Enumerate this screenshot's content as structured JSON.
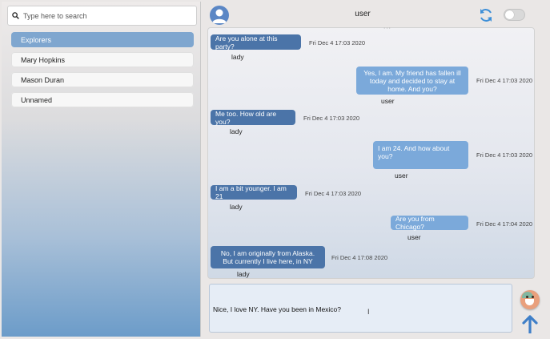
{
  "search": {
    "placeholder": "Type here to search"
  },
  "sidebar": {
    "contacts": [
      {
        "label": "Explorers",
        "active": true
      },
      {
        "label": "Mary Hopkins",
        "active": false
      },
      {
        "label": "Mason Duran",
        "active": false
      },
      {
        "label": "Unnamed",
        "active": false
      }
    ]
  },
  "header": {
    "title": "user"
  },
  "icons": {
    "search": "search-icon",
    "avatar": "user-avatar-icon",
    "sync": "sync-icon",
    "emoji": "emoji-icon",
    "send": "arrow-up-icon"
  },
  "colors": {
    "incoming_bubble": "#4b74a8",
    "outgoing_bubble": "#7ba9da",
    "active_contact": "#7fa6cf",
    "accent": "#5b87c5"
  },
  "messages": [
    {
      "text": "Are you alone at this party?",
      "time": "Fri Dec 4 17:03 2020",
      "sender": "lady",
      "direction": "in"
    },
    {
      "text": "Yes, I am. My friend has fallen ill today and decided to stay at home. And you?",
      "time": "Fri Dec 4 17:03 2020",
      "sender": "user",
      "direction": "out"
    },
    {
      "text": "Me too. How old are you?",
      "time": "Fri Dec 4 17:03 2020",
      "sender": "lady",
      "direction": "in"
    },
    {
      "text": "I am 24. And how about you?",
      "time": "Fri Dec 4 17:03 2020",
      "sender": "user",
      "direction": "out"
    },
    {
      "text": "I am a bit younger. I am 21",
      "time": "Fri Dec 4 17:03 2020",
      "sender": "lady",
      "direction": "in"
    },
    {
      "text": "Are you from Chicago?",
      "time": "Fri Dec 4 17:04 2020",
      "sender": "user",
      "direction": "out"
    },
    {
      "text": "No, I am originally from Alaska. But currently I live here, in NY",
      "time": "Fri Dec 4 17:08 2020",
      "sender": "lady",
      "direction": "in"
    }
  ],
  "composer": {
    "text": "Nice, I love NY. Have you been in Mexico?"
  }
}
